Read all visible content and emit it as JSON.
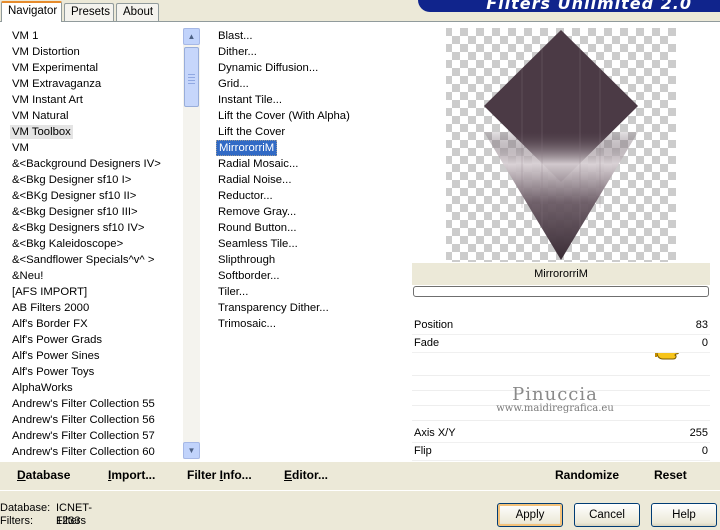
{
  "window": {
    "title": "Filters Unlimited 2.0"
  },
  "tabs": [
    {
      "label": "Navigator",
      "active": true
    },
    {
      "label": "Presets",
      "active": false
    },
    {
      "label": "About",
      "active": false
    }
  ],
  "categories": [
    "VM 1",
    "VM Distortion",
    "VM Experimental",
    "VM Extravaganza",
    "VM Instant Art",
    "VM Natural",
    "VM Toolbox",
    "VM",
    "&<Background Designers IV>",
    "&<Bkg Designer sf10 I>",
    "&<BKg Designer sf10 II>",
    "&<Bkg Designer sf10 III>",
    "&<Bkg Designers sf10 IV>",
    "&<Bkg Kaleidoscope>",
    "&<Sandflower Specials^v^ >",
    "&Neu!",
    "[AFS IMPORT]",
    "AB Filters 2000",
    "Alf's Border FX",
    "Alf's Power Grads",
    "Alf's Power Sines",
    "Alf's Power Toys",
    "AlphaWorks",
    "Andrew's Filter Collection 55",
    "Andrew's Filter Collection 56",
    "Andrew's Filter Collection 57",
    "Andrew's Filter Collection 60"
  ],
  "selected_category": "VM Toolbox",
  "filters": [
    "Blast...",
    "Dither...",
    "Dynamic Diffusion...",
    "Grid...",
    "Instant Tile...",
    "Lift the Cover (With Alpha)",
    "Lift the Cover",
    "MirrororriM",
    "Radial Mosaic...",
    "Radial Noise...",
    "Reductor...",
    "Remove Gray...",
    "Round Button...",
    "Seamless Tile...",
    "Slipthrough",
    "Softborder...",
    "Tiler...",
    "Transparency Dither...",
    "Trimosaic..."
  ],
  "selected_filter": "MirrororriM",
  "preview": {
    "filter_name": "MirrororriM",
    "progress_fraction": 0
  },
  "params": {
    "position": {
      "label": "Position",
      "value": "83"
    },
    "fade": {
      "label": "Fade",
      "value": "0"
    },
    "axis": {
      "label": "Axis X/Y",
      "value": "255"
    },
    "flip": {
      "label": "Flip",
      "value": "0"
    }
  },
  "watermark": {
    "line1": "Pinuccia",
    "line2": "www.maidiregrafica.eu"
  },
  "bottom_links": {
    "database": {
      "underline": "D",
      "rest": "atabase"
    },
    "import": {
      "underline": "I",
      "rest": "mport..."
    },
    "filter_info": {
      "before": "Filter ",
      "underline": "I",
      "after": "nfo..."
    },
    "editor": {
      "underline": "E",
      "rest": "ditor..."
    },
    "randomize": "Randomize",
    "reset": "Reset"
  },
  "status": {
    "database_label": "Database:",
    "database_value": "ICNET-Filters",
    "filters_label": "Filters:",
    "filters_value": "1233"
  },
  "buttons": {
    "apply": "Apply",
    "cancel": "Cancel",
    "help": "Help"
  },
  "colors": {
    "banner": "#10248c",
    "selection": "#316ac5",
    "tab_accent": "#e68b2c",
    "preview_shape": "#4b3a45"
  },
  "icons": {
    "pointer": "pointing-hand-icon"
  }
}
